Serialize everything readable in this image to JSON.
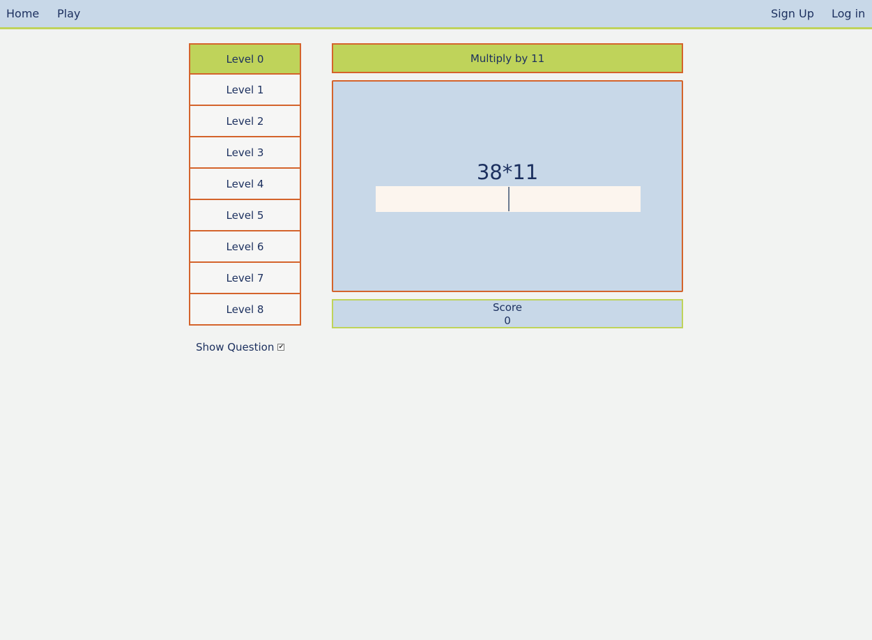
{
  "nav": {
    "home": "Home",
    "play": "Play",
    "sign_up": "Sign Up",
    "log_in": "Log in"
  },
  "levels": [
    {
      "label": "Level 0",
      "active": true
    },
    {
      "label": "Level 1",
      "active": false
    },
    {
      "label": "Level 2",
      "active": false
    },
    {
      "label": "Level 3",
      "active": false
    },
    {
      "label": "Level 4",
      "active": false
    },
    {
      "label": "Level 5",
      "active": false
    },
    {
      "label": "Level 6",
      "active": false
    },
    {
      "label": "Level 7",
      "active": false
    },
    {
      "label": "Level 8",
      "active": false
    }
  ],
  "show_question": {
    "label": "Show Question",
    "checked": true
  },
  "game": {
    "title": "Multiply by 11",
    "question": "38*11",
    "answer_value": ""
  },
  "score": {
    "label": "Score",
    "value": "0"
  },
  "colors": {
    "accent_green": "#bfd35a",
    "border_orange": "#d4632b",
    "panel_blue": "#c8d8e8",
    "text_navy": "#1b2f5e"
  }
}
